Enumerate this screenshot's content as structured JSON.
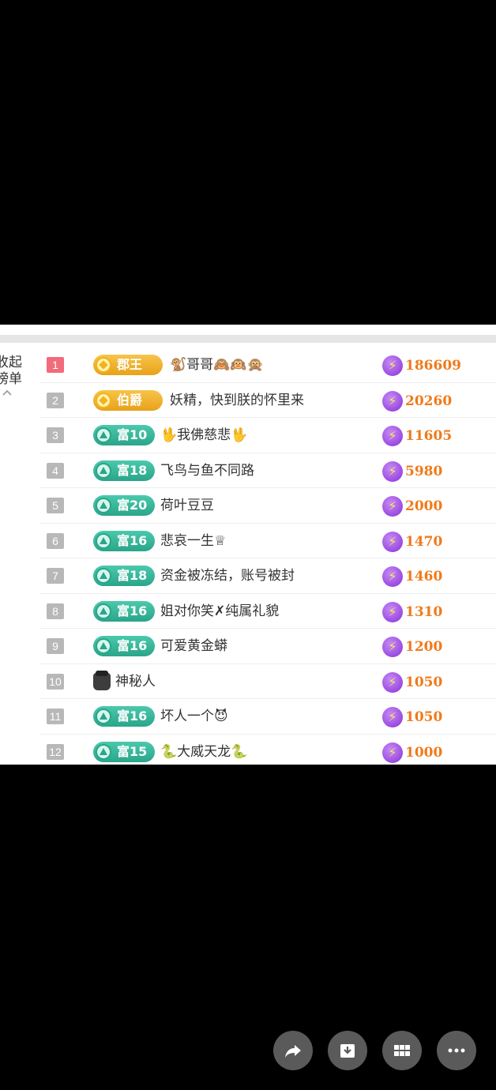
{
  "side_label": {
    "line1": "收起",
    "line2": "榜单",
    "chevron": "chevron-up-icon"
  },
  "rows": [
    {
      "rank": "1",
      "badge": "郡王",
      "badge_type": "gold",
      "name": "🐒哥哥🙈🙉🙊",
      "score": "186609"
    },
    {
      "rank": "2",
      "badge": "伯爵",
      "badge_type": "gold",
      "name": "妖精，快到朕的怀里来",
      "score": "20260"
    },
    {
      "rank": "3",
      "badge": "富10",
      "badge_type": "green",
      "name": "🖖我佛慈悲🖖",
      "score": "11605"
    },
    {
      "rank": "4",
      "badge": "富18",
      "badge_type": "green",
      "name": "飞鸟与鱼不同路",
      "score": "5980"
    },
    {
      "rank": "5",
      "badge": "富20",
      "badge_type": "green",
      "name": "荷叶豆豆",
      "score": "2000"
    },
    {
      "rank": "6",
      "badge": "富16",
      "badge_type": "green",
      "name": "悲哀一生♕",
      "score": "1470"
    },
    {
      "rank": "7",
      "badge": "富18",
      "badge_type": "green",
      "name": "资金被冻结，账号被封",
      "score": "1460"
    },
    {
      "rank": "8",
      "badge": "富16",
      "badge_type": "green",
      "name": "姐对你笑✗纯属礼貌",
      "score": "1310"
    },
    {
      "rank": "9",
      "badge": "富16",
      "badge_type": "green",
      "name": "可爱黄金蟒",
      "score": "1200"
    },
    {
      "rank": "10",
      "badge": "",
      "badge_type": "mystery",
      "name": "神秘人",
      "score": "1050"
    },
    {
      "rank": "11",
      "badge": "富16",
      "badge_type": "green",
      "name": "坏人一个😈",
      "score": "1050"
    },
    {
      "rank": "12",
      "badge": "富15",
      "badge_type": "green",
      "name": "🐍大威天龙🐍",
      "score": "1000"
    }
  ],
  "colors": {
    "rank1": "#f26b7a",
    "score": "#f07a1a",
    "gold_badge": "#e8a21a",
    "green_badge": "#2aa589",
    "bolt": "#8a2fd8"
  },
  "icons": {
    "score_icon": "lightning-bolt-icon",
    "fabs": [
      "share-icon",
      "download-icon",
      "grid-icon",
      "more-icon"
    ]
  }
}
